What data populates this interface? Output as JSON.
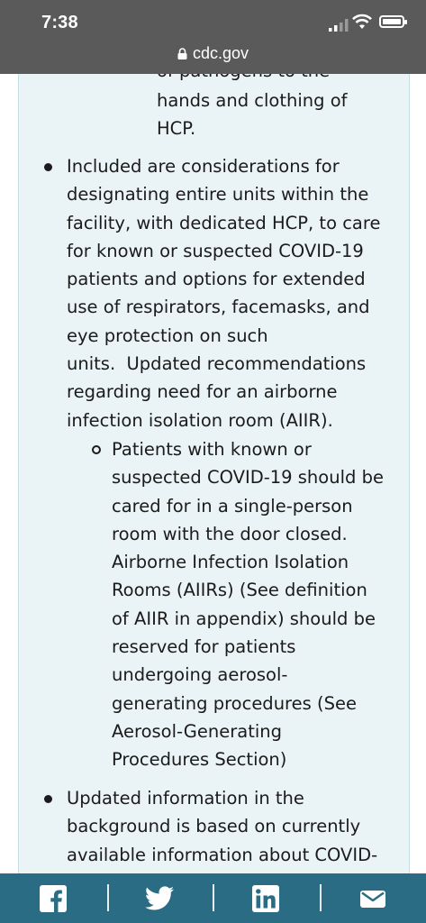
{
  "status_bar": {
    "time": "7:38",
    "url": "cdc.gov",
    "icons": [
      "cellular-signal-icon",
      "wifi-icon",
      "battery-icon",
      "lock-icon"
    ]
  },
  "content": {
    "cutoff_line": "of pathogens to the",
    "continuation_lines": [
      "hands and clothing of",
      "HCP."
    ],
    "bullet1_lines": [
      "Included are considerations for",
      "designating entire units within the",
      "facility, with dedicated HCP, to care",
      "for known or suspected COVID-19",
      "patients and options for extended",
      "use of respirators, facemasks, and",
      "eye protection on such",
      "units.  Updated recommendations",
      "regarding need for an airborne",
      "infection isolation room (AIIR)."
    ],
    "subbullet_lines": [
      "Patients with known or",
      "suspected COVID-19 should be",
      "cared for in a single-person",
      "room with the door closed.",
      "Airborne Infection Isolation",
      "Rooms (AIIRs) (See definition",
      "of AIIR in appendix) should be",
      "reserved for patients",
      "undergoing aerosol-",
      "generating procedures (See",
      "Aerosol-Generating",
      "Procedures Section)"
    ],
    "bullet2_lines": [
      "Updated information in the",
      "background is based on currently",
      "available information about COVID-"
    ]
  },
  "share_bar": {
    "icons": [
      "facebook-icon",
      "twitter-icon",
      "linkedin-icon",
      "email-icon"
    ],
    "background": "#2b6c85"
  },
  "colors": {
    "panel_bg": "#eaf3f6",
    "status_bg": "#5a5a5a",
    "text": "#1b1b1b"
  }
}
